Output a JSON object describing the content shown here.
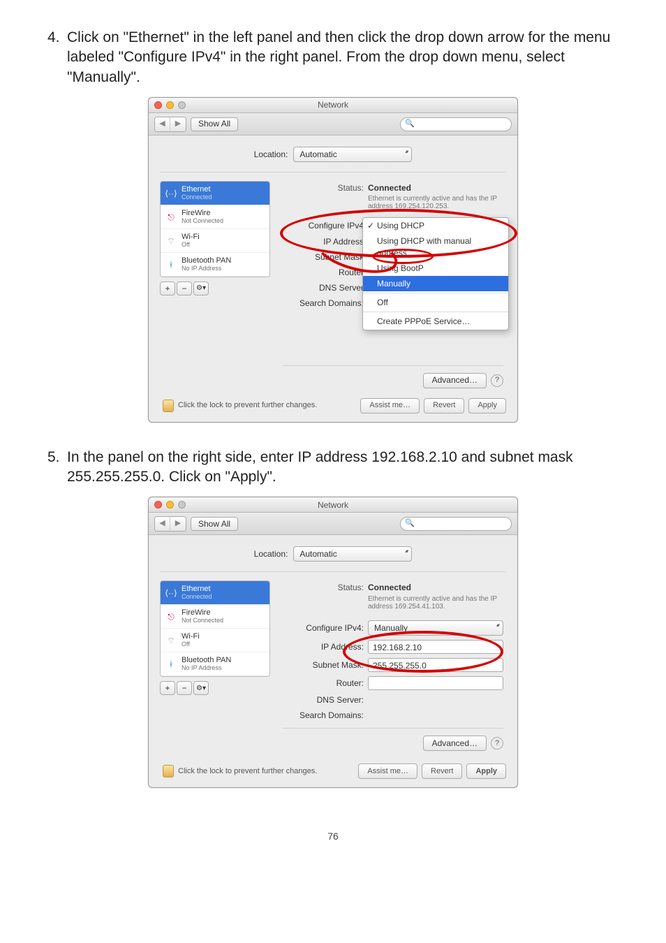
{
  "steps": {
    "s4": {
      "num": "4.",
      "text": "Click on \"Ethernet\" in the left panel and then click the drop down arrow for the menu labeled \"Configure IPv4\" in the right panel. From the drop down menu, select \"Manually\"."
    },
    "s5": {
      "num": "5.",
      "text": "In the panel on the right side, enter IP address 192.168.2.10 and subnet mask 255.255.255.0. Click on \"Apply\"."
    }
  },
  "win": {
    "title": "Network",
    "show_all": "Show All",
    "search_icon": "🔍",
    "loc_label": "Location:",
    "loc_value": "Automatic"
  },
  "side": {
    "eth": {
      "name": "Ethernet",
      "sub": "Connected"
    },
    "fw": {
      "name": "FireWire",
      "sub": "Not Connected"
    },
    "wifi": {
      "name": "Wi-Fi",
      "sub": "Off"
    },
    "bt": {
      "name": "Bluetooth PAN",
      "sub": "No IP Address"
    },
    "add": "+",
    "remove": "−",
    "gear": "⚙▾"
  },
  "labels": {
    "status": "Status:",
    "configure": "Configure IPv4",
    "configure_colon": "Configure IPv4:",
    "ip": "IP Address",
    "ip_colon": "IP Address:",
    "subnet": "Subnet Mask",
    "subnet_colon": "Subnet Mask:",
    "router": "Router",
    "router_colon": "Router:",
    "dns": "DNS Server",
    "dns_colon": "DNS Server:",
    "search": "Search Domains:",
    "advanced": "Advanced…",
    "assist": "Assist me…",
    "revert": "Revert",
    "apply": "Apply",
    "help": "?",
    "lock": "Click the lock to prevent further changes."
  },
  "status1": {
    "value": "Connected",
    "sub": "Ethernet is currently active and has the IP address 169.254.120.253."
  },
  "dropdown": {
    "d1": "Using DHCP",
    "d2": "Using DHCP with manual address",
    "d3": "Using BootP",
    "d4": "Manually",
    "d5": "Off",
    "d6": "Create PPPoE Service…"
  },
  "status2": {
    "value": "Connected",
    "sub": "Ethernet is currently active and has the IP address 169.254.41.103.",
    "configure_val": "Manually",
    "ip_val": "192.168.2.10",
    "subnet_val": "255.255.255.0"
  },
  "page_num": "76"
}
